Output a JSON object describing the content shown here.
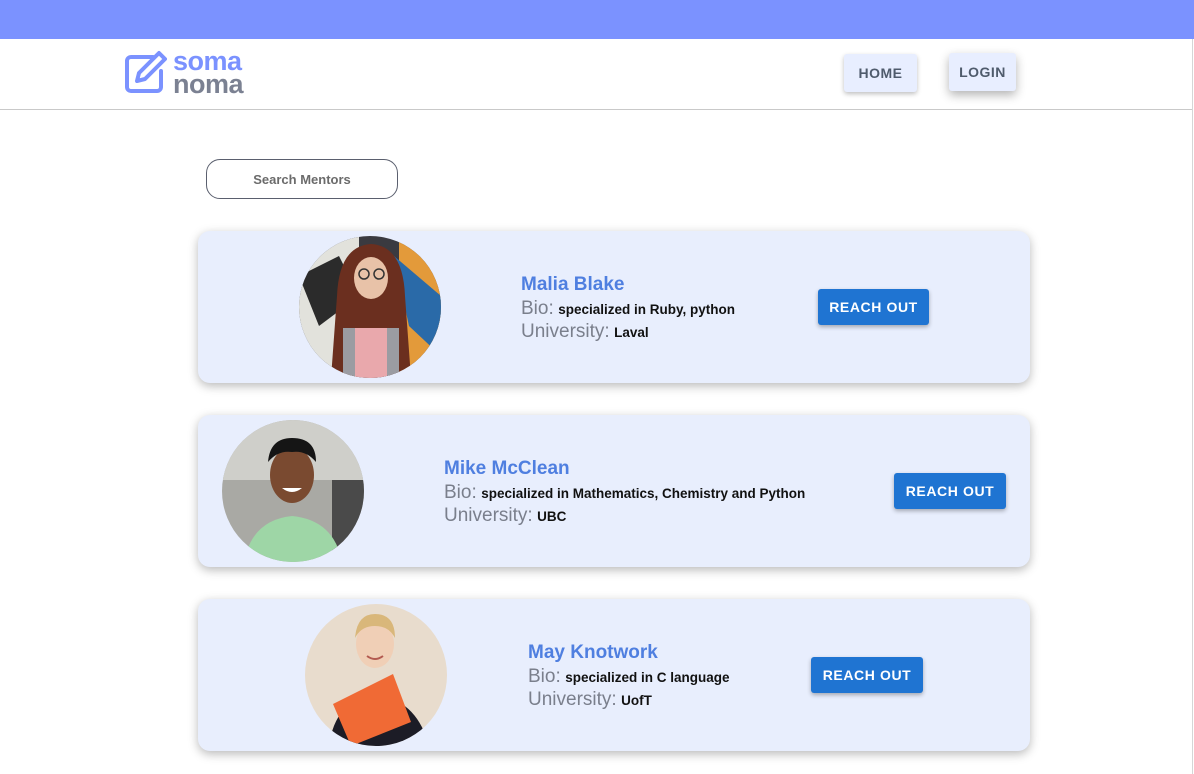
{
  "brand": {
    "line1": "soma",
    "line2": "noma"
  },
  "nav": {
    "home": "HOME",
    "login": "LOGIN"
  },
  "search": {
    "placeholder": "Search Mentors"
  },
  "labels": {
    "bio": "Bio:",
    "university": "University:"
  },
  "mentors": [
    {
      "name": "Malia Blake",
      "bio": "specialized in Ruby, python",
      "university": "Laval",
      "action": "REACH OUT"
    },
    {
      "name": "Mike McClean",
      "bio": "specialized in Mathematics, Chemistry and Python",
      "university": "UBC",
      "action": "REACH OUT"
    },
    {
      "name": "May Knotwork",
      "bio": "specialized in C language",
      "university": "UofT",
      "action": "REACH OUT"
    }
  ],
  "colors": {
    "topbar": "#7b92ff",
    "card": "#e8eefd",
    "accent_button": "#1f74d2",
    "name_text": "#4f7fe0"
  }
}
